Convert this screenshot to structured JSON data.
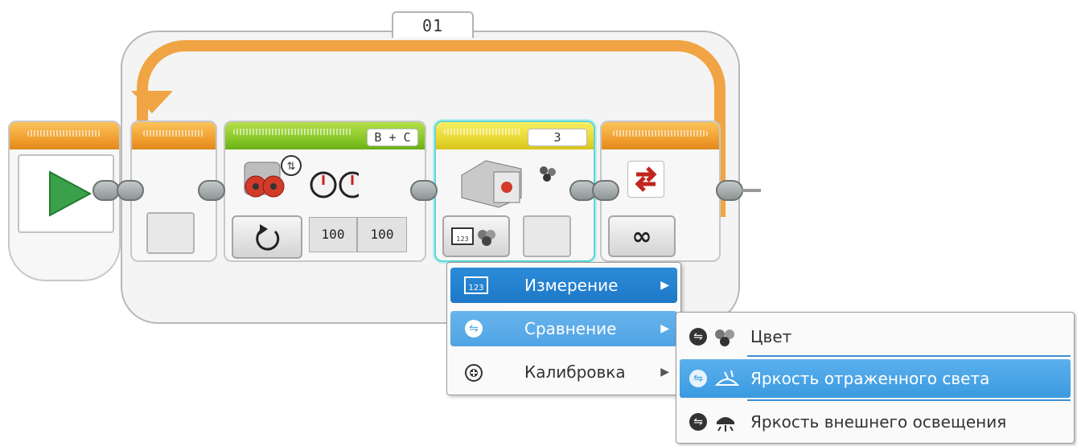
{
  "loop": {
    "name": "01"
  },
  "motor": {
    "ports": "B + C",
    "power_left": "100",
    "power_right": "100"
  },
  "sensor": {
    "port": "3"
  },
  "menu": {
    "items": [
      {
        "label": "Измерение",
        "icon": "ruler-123-icon",
        "state": "active"
      },
      {
        "label": "Сравнение",
        "icon": "compare-icon",
        "state": "hover"
      },
      {
        "label": "Калибровка",
        "icon": "calibrate-icon",
        "state": "normal"
      }
    ]
  },
  "submenu": {
    "items": [
      {
        "label": "Цвет",
        "icon": "color-dots-icon",
        "selected": false
      },
      {
        "label": "Яркость отраженного света",
        "icon": "reflected-light-icon",
        "selected": true
      },
      {
        "label": "Яркость внешнего освещения",
        "icon": "ambient-light-icon",
        "selected": false
      }
    ]
  },
  "colors": {
    "loop": "#f0a443",
    "motor_header": "#80c324",
    "sensor_header": "#e6d52c",
    "selection": "#1e78c8",
    "sensor_highlight": "#5fd6d6"
  }
}
